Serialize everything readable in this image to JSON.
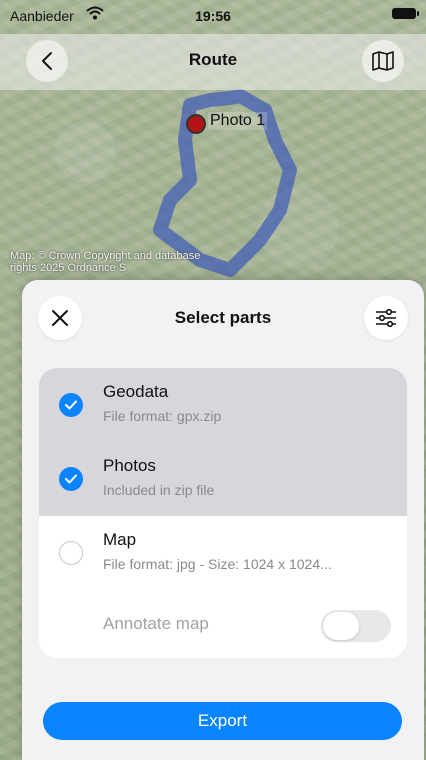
{
  "status_bar": {
    "carrier": "Aanbieder",
    "time": "19:56"
  },
  "nav": {
    "title": "Route",
    "back_icon": "chevron-left-icon",
    "map_icon": "map-icon"
  },
  "map": {
    "pin_label": "Photo 1",
    "attribution": "Map: © Crown Copyright and database rights 2025 Ordnance S"
  },
  "sheet": {
    "title": "Select parts",
    "close_icon": "close-icon",
    "settings_icon": "sliders-icon",
    "items": [
      {
        "title": "Geodata",
        "subtitle": "File format: gpx.zip",
        "selected": true
      },
      {
        "title": "Photos",
        "subtitle": "Included in zip file",
        "selected": true
      },
      {
        "title": "Map",
        "subtitle": "File format: jpg - Size: 1024 x 1024...",
        "selected": false
      }
    ],
    "annotate": {
      "label": "Annotate map",
      "enabled": false
    },
    "export_label": "Export"
  },
  "colors": {
    "accent": "#0a84ff",
    "pin": "#b51414",
    "route": "#3f5fd6"
  }
}
